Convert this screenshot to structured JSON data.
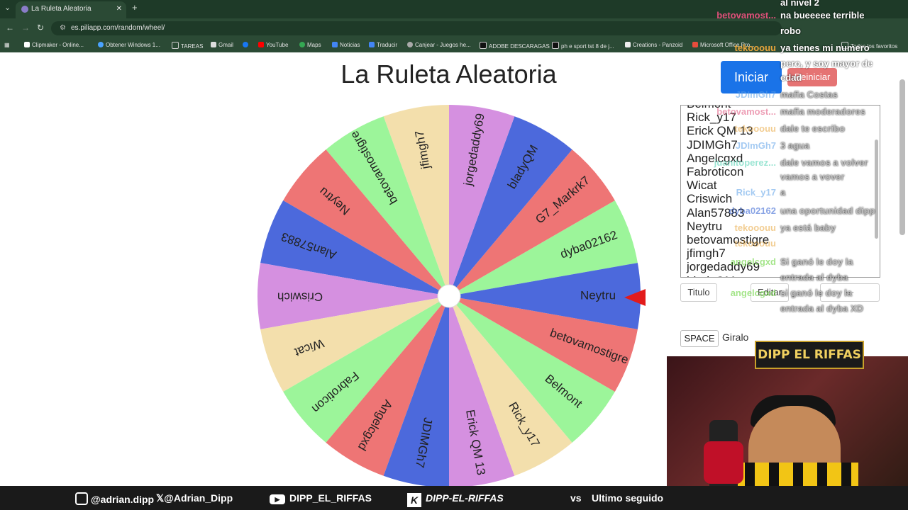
{
  "browser": {
    "tab_title": "La Ruleta Aleatoria",
    "url": "es.piliapp.com/random/wheel/",
    "bookmarks": [
      "Clipmaker - Online...",
      "Obtener Windows 1...",
      "TAREAS",
      "Gmail",
      "",
      "YouTube",
      "Maps",
      "Noticias",
      "Traducir",
      "Canjear - Juegos he...",
      "ADOBE DESCARAGAS",
      "ph e sport tst 8 de j...",
      "Creations - Panzoid",
      "Microsoft Office Pro...",
      "Todos los favoritos"
    ]
  },
  "page": {
    "title": "La Ruleta Aleatoria",
    "start_label": "Iniciar",
    "reset_label": "Reiniciar",
    "title_field": "Titulo",
    "edit_label": "Editar",
    "shortcut_key": "SPACE",
    "shortcut_action": "Giralo",
    "names_list": [
      "Belmont",
      "Rick_y17",
      "Erick QM 13",
      "JDIMGh7",
      "Angelcgxd",
      "Fabroticon",
      "Wicat",
      "Criswich",
      "Alan57883",
      "Neytru",
      "betovamostigre",
      "jfimgh7",
      "jorgedaddy69",
      "bladyQM"
    ]
  },
  "wheel": {
    "selected": "dyba02162",
    "segments": [
      {
        "label": "dyba02162",
        "color": "#9cf59a"
      },
      {
        "label": "G7_Markrk7",
        "color": "#ee7575"
      },
      {
        "label": "bladyQM",
        "color": "#4c69dc"
      },
      {
        "label": "jorgedaddy69",
        "color": "#d590e0"
      },
      {
        "label": "jfimgh7",
        "color": "#f3dfac"
      },
      {
        "label": "betovamostigre",
        "color": "#9cf59a"
      },
      {
        "label": "Neytru",
        "color": "#ee7575"
      },
      {
        "label": "Alan57883",
        "color": "#4c69dc"
      },
      {
        "label": "Criswich",
        "color": "#d590e0"
      },
      {
        "label": "Wicat",
        "color": "#f3dfac"
      },
      {
        "label": "Fabroticon",
        "color": "#9cf59a"
      },
      {
        "label": "Angelcgxd",
        "color": "#ee7575"
      },
      {
        "label": "JDIMGh7",
        "color": "#4c69dc"
      },
      {
        "label": "Erick QM 13",
        "color": "#d590e0"
      },
      {
        "label": "Rick_y17",
        "color": "#f3dfac"
      },
      {
        "label": "Belmont",
        "color": "#9cf59a"
      },
      {
        "label": "betovamostigre",
        "color": "#ee7575"
      },
      {
        "label": "Neytru",
        "color": "#4c69dc"
      }
    ]
  },
  "chat": [
    {
      "user": "",
      "text": "al nivel 2",
      "color": "#ffffff"
    },
    {
      "user": "betovamost...",
      "text": "na bueeeee terrible",
      "color": "#e0507a"
    },
    {
      "user": "",
      "text": "robo",
      "color": "#ffffff"
    },
    {
      "user": "tekooouu",
      "text": "ya tienes mi numero",
      "color": "#e8a53a"
    },
    {
      "user": "",
      "text": "pero, y soy mayor de",
      "color": "#ffffff"
    },
    {
      "user": "",
      "text": "edad",
      "color": "#ffffff"
    },
    {
      "user": "JDImGh7",
      "text": "mafia Costas",
      "color": "#5aa0e8"
    },
    {
      "user": "betovamost...",
      "text": "mafia moderadores",
      "color": "#e0507a"
    },
    {
      "user": "tekooouu",
      "text": "dale te escribo",
      "color": "#e8a53a"
    },
    {
      "user": "JDImGh7",
      "text": "3 agua",
      "color": "#5aa0e8"
    },
    {
      "user": "juanitoperez...",
      "text": "dale vamos a volver",
      "color": "#4ad0b0"
    },
    {
      "user": "",
      "text": "vamos a vover",
      "color": "#ffffff"
    },
    {
      "user": "Rick_y17",
      "text": "a",
      "color": "#5aa0e8"
    },
    {
      "user": "dyba02162",
      "text": "una oportunidad dipp",
      "color": "#2a5ad0"
    },
    {
      "user": "tekooouu",
      "text": "ya está baby",
      "color": "#e8a53a"
    },
    {
      "user": "tekooouu",
      "text": "",
      "color": "#e8a53a"
    },
    {
      "user": "angelcgxd",
      "text": "Si ganó le doy la",
      "color": "#5ad02a"
    },
    {
      "user": "",
      "text": "entrada al dyba",
      "color": "#ffffff"
    },
    {
      "user": "angelcgxd",
      "text": "si ganó le doy la",
      "color": "#5ad02a"
    },
    {
      "user": "",
      "text": "entrada al dyba XD",
      "color": "#ffffff"
    }
  ],
  "stream": {
    "logo_text": "DIPP EL RIFFAS",
    "ticker": {
      "instagram": "@adrian.dipp",
      "x": "@Adrian_Dipp",
      "youtube": "DIPP_EL_RIFFAS",
      "kick": "DIPP-EL-RIFFAS",
      "vs": "vs",
      "last_follow": "Ultimo seguido"
    }
  },
  "colors": {
    "accent": "#1a73e8",
    "reset": "#e57373",
    "pointer": "#e21b1b"
  }
}
